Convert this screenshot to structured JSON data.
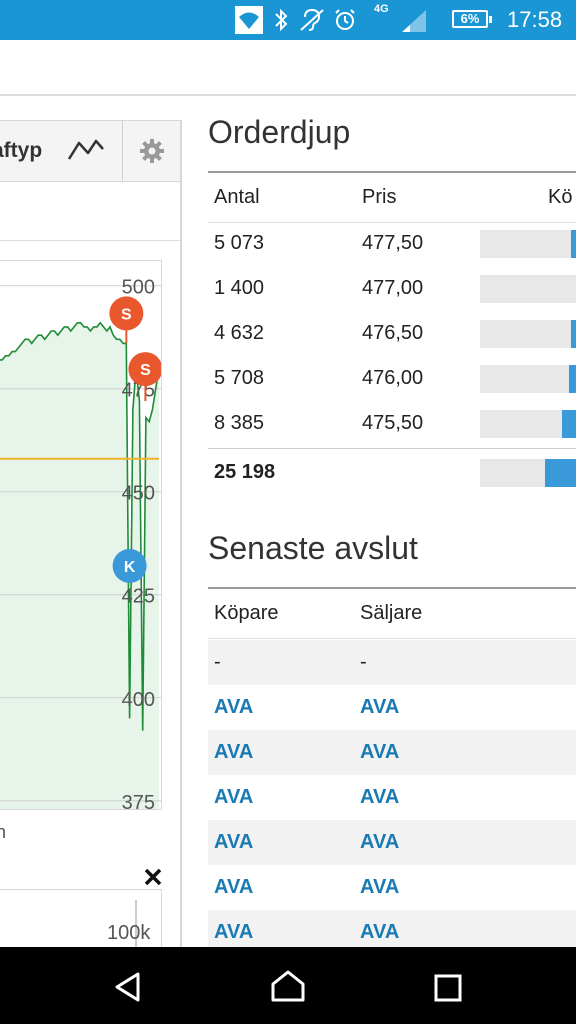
{
  "status_bar": {
    "network": "4G",
    "battery": "6%",
    "time": "17:58",
    "icons": [
      "wifi-icon",
      "bluetooth-icon",
      "hearing-aid-icon",
      "alarm-icon",
      "signal-icon",
      "battery-icon"
    ]
  },
  "chart_widget": {
    "chart_type_label": "aftyp",
    "y_tick_labels": [
      "500",
      "475",
      "450",
      "425",
      "400",
      "375"
    ],
    "markers": [
      {
        "label": "S",
        "color": "#e8582c"
      },
      {
        "label": "S",
        "color": "#e8582c"
      },
      {
        "label": "K",
        "color": "#3a9ad9"
      }
    ],
    "volume_label": "100k",
    "stray_text": "n"
  },
  "chart_data": {
    "type": "line",
    "ylim": [
      373,
      506
    ],
    "y_ticks": [
      500,
      475,
      450,
      425,
      400,
      375
    ],
    "series": [
      {
        "color": "#1e8c36",
        "values": [
          482,
          482,
          483,
          483,
          484,
          484,
          485,
          486,
          487,
          487,
          486,
          487,
          488,
          488,
          487,
          488,
          489,
          489,
          488,
          489,
          490,
          490,
          489,
          490,
          491,
          491,
          490,
          490,
          489,
          490,
          490,
          491,
          490,
          489,
          490,
          488,
          487,
          487,
          486,
          486,
          395,
          470,
          480,
          472,
          392,
          468,
          467,
          470,
          475,
          480
        ]
      },
      {
        "color": "#f0b429",
        "values": [
          458,
          458,
          458,
          458,
          458,
          458,
          458,
          458,
          458,
          458,
          458,
          458,
          458,
          458,
          458,
          458,
          458,
          458,
          458,
          458,
          458,
          458,
          458,
          458,
          458,
          458,
          458,
          458,
          458,
          458,
          458,
          458,
          458,
          458,
          458,
          458,
          458,
          458,
          458,
          458,
          458,
          458,
          458,
          458,
          458,
          458,
          458,
          458,
          458,
          458
        ]
      }
    ]
  },
  "orderbook": {
    "title": "Orderdjup",
    "columns": [
      "Antal",
      "Pris",
      "Kö"
    ],
    "rows": [
      {
        "antal": "5 073",
        "pris": "477,50",
        "fill": 0.05
      },
      {
        "antal": "1 400",
        "pris": "477,00",
        "fill": 0.0
      },
      {
        "antal": "4 632",
        "pris": "476,50",
        "fill": 0.05
      },
      {
        "antal": "5 708",
        "pris": "476,00",
        "fill": 0.07
      },
      {
        "antal": "8 385",
        "pris": "475,50",
        "fill": 0.15
      }
    ],
    "total": "25 198",
    "total_fill": 0.32
  },
  "trades": {
    "title": "Senaste avslut",
    "columns": [
      "Köpare",
      "Säljare"
    ],
    "rows": [
      {
        "buyer": "-",
        "seller": "-"
      },
      {
        "buyer": "AVA",
        "seller": "AVA"
      },
      {
        "buyer": "AVA",
        "seller": "AVA"
      },
      {
        "buyer": "AVA",
        "seller": "AVA"
      },
      {
        "buyer": "AVA",
        "seller": "AVA"
      },
      {
        "buyer": "AVA",
        "seller": "AVA"
      },
      {
        "buyer": "AVA",
        "seller": "AVA"
      }
    ]
  },
  "colors": {
    "status_bar": "#1a96d4",
    "accent_blue": "#3a9ad9",
    "link_blue": "#1a7ab3",
    "sell_marker": "#e8582c",
    "price_line": "#1e8c36",
    "avg_line": "#f0b429"
  }
}
